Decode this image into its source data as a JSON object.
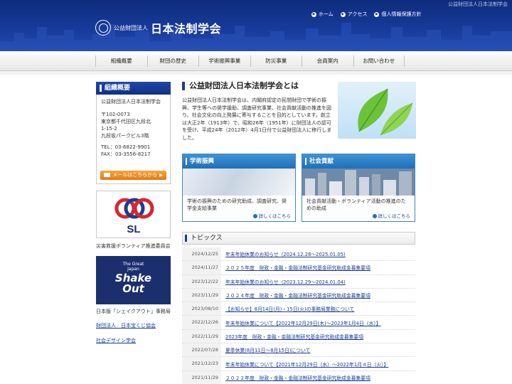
{
  "header": {
    "tagline": "公益財団法人日本法制学会",
    "logo_sub": "公益財団法人",
    "logo_main": "日本法制学会",
    "util_links": [
      "ホーム",
      "アクセス",
      "個人情報保護方針"
    ]
  },
  "nav": [
    "組織概要",
    "財団の歴史",
    "学術振興事業",
    "防災事業",
    "会員案内",
    "お問い合わせ"
  ],
  "sidebar": {
    "title": "組織概要",
    "org_name": "公益財団法人日本法制学会",
    "address": [
      "〒102-0073",
      "東京都千代田区九段北",
      "1-15-2",
      "九段坂パークビル3階"
    ],
    "tel": "TEL：03-6822-9901",
    "fax": "FAX：03-3556-8217",
    "mail_button": "メールはこちらから",
    "sl_logo_text": "SL",
    "sl_label": "災害救援ボランティア推進委員会",
    "shakeout_line1": "The Great",
    "shakeout_line2": "Japan",
    "shakeout_main1": "Shake",
    "shakeout_main2": "Out",
    "shakeout_label": "日本版「シェイクアウト」事務局",
    "links": [
      "財団法人　日本宝くじ協会",
      "社会デザイン学会"
    ]
  },
  "about": {
    "heading": "公益財団法人日本法制学会とは",
    "text": "公益財団法人日本法制学会は、内閣府認定の民間財団で学術の振興、学生等への奨学援助、調査研究事業、社会貢献活動の推進を図り、社会文化の向上発展に寄与することを目的としています。創立は大正2年（1913年）で、昭和26年（1951年）に財団法人の認可を受け、平成24年（2012年）4月1日付で公益財団法人に移行しました。"
  },
  "cards": [
    {
      "title": "学術振興",
      "text": "学術の振興のための研究助成、調査研究、奨学金支給事業",
      "more": "詳しくはこちら"
    },
    {
      "title": "社会貢献",
      "text": "社会貢献活動・ボランティア活動の推進のための助成",
      "more": "詳しくはこちら"
    }
  ],
  "topics": {
    "heading": "トピックス",
    "items": [
      {
        "date": "2024/12/25",
        "title": "年末年始休業のお知らせ（2024.12.28～2025.01.05)"
      },
      {
        "date": "2024/11/27",
        "title": "２０２５年度　財政・金融・金融法制研究基金研究助成金募集要項"
      },
      {
        "date": "2023/12/22",
        "title": "年末年始休業のお知らせ（2023.12.29～2024.01.04)"
      },
      {
        "date": "2023/11/29",
        "title": "２０２４年度　財政・金融・金融法制研究基金研究助成金募集要項"
      },
      {
        "date": "2023/08/10",
        "title": "【お知らせ】8月14日(月)・15日(火)の事務局業務について"
      },
      {
        "date": "2022/12/26",
        "title": "年末年始休業について【2022年12月29日(木)〜2023年1月4日（水）】"
      },
      {
        "date": "2022/11/29",
        "title": "2023年度　財政・金融・金融法制研究基金研究助成金募集要項"
      },
      {
        "date": "2022/07/28",
        "title": "夏季休業(8月11日～8月15日)について"
      },
      {
        "date": "2021/12/23",
        "title": "年末年始休業について【2021年12月29日（水）〜2022年1月４日（火）】"
      },
      {
        "date": "2021/11/29",
        "title": "２０２２年度　財政・金融・金融法制研究基金研究助成金募集要項"
      }
    ]
  },
  "colors": {
    "header_blue": "#173a9a",
    "card_blue": "#1f6fb8",
    "mail_orange": "#e47c0c",
    "sl_red": "#d8262e",
    "sl_blue": "#1b3c96"
  }
}
